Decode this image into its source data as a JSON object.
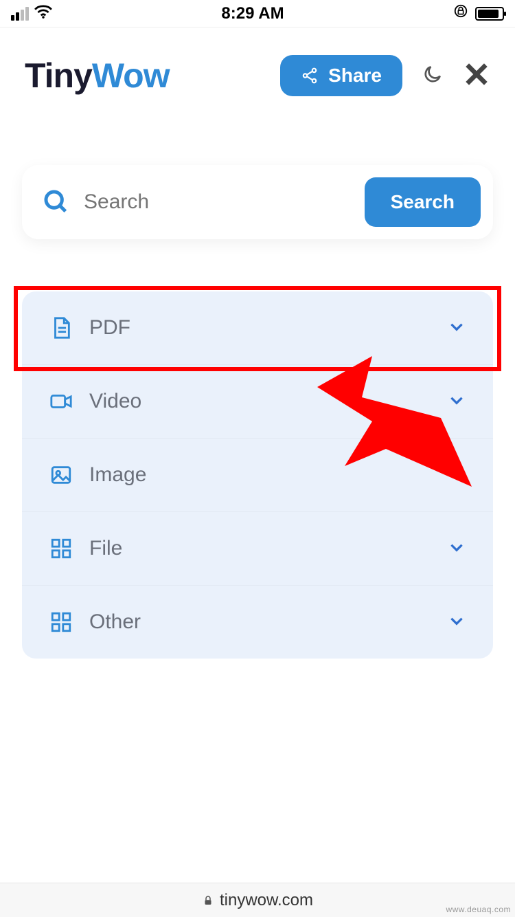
{
  "status": {
    "time": "8:29 AM"
  },
  "brand": {
    "part1": "Tiny",
    "part2": "Wow"
  },
  "header": {
    "share_label": "Share"
  },
  "search": {
    "placeholder": "Search",
    "button_label": "Search"
  },
  "categories": [
    {
      "icon": "file-icon",
      "label": "PDF"
    },
    {
      "icon": "video-icon",
      "label": "Video"
    },
    {
      "icon": "image-icon",
      "label": "Image"
    },
    {
      "icon": "grid-icon",
      "label": "File"
    },
    {
      "icon": "grid-icon",
      "label": "Other"
    }
  ],
  "browser": {
    "domain": "tinywow.com"
  },
  "watermark": "www.deuaq.com",
  "annotation": {
    "highlighted_index": 0
  },
  "colors": {
    "accent": "#2f8ad6",
    "panel_bg": "#eaf1fb",
    "highlight": "#ff0000"
  }
}
